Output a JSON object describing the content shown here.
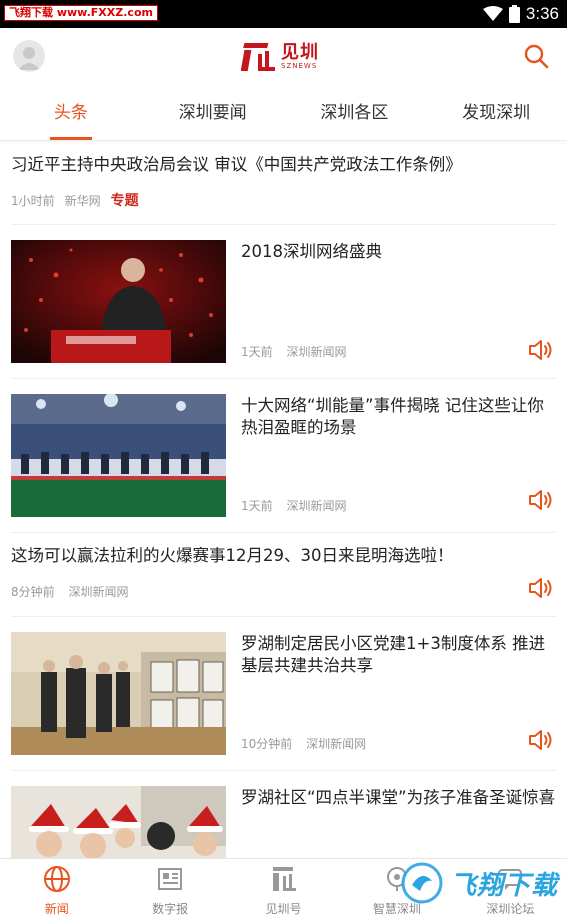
{
  "status_bar": {
    "watermark_badge": "飞翔下载 www.FXXZ.com",
    "time": "3:36"
  },
  "header": {
    "logo_text": "见圳",
    "logo_sub": "SZNEWS",
    "brand_color": "#c4161c",
    "accent_color": "#e8541e"
  },
  "tabs": [
    {
      "label": "头条",
      "active": true
    },
    {
      "label": "深圳要闻",
      "active": false
    },
    {
      "label": "深圳各区",
      "active": false
    },
    {
      "label": "发现深圳",
      "active": false
    }
  ],
  "feed": [
    {
      "type": "text",
      "title": "习近平主持中央政治局会议 审议《中国共产党政法工作条例》",
      "time": "1小时前",
      "source": "新华网",
      "tag": "专题"
    },
    {
      "type": "image",
      "title": "2018深圳网络盛典",
      "time": "1天前",
      "source": "深圳新闻网",
      "image": "speaker-on-stage",
      "audio": true
    },
    {
      "type": "image",
      "title": "十大网络“圳能量”事件揭晓 记住这些让你热泪盈眶的场景",
      "time": "1天前",
      "source": "深圳新闻网",
      "image": "award-ceremony-stage",
      "audio": true
    },
    {
      "type": "text",
      "title": "这场可以赢法拉利的火爆赛事12月29、30日来昆明海选啦！",
      "time": "8分钟前",
      "source": "深圳新闻网",
      "audio": true
    },
    {
      "type": "image",
      "title": "罗湖制定居民小区党建1+3制度体系 推进基层共建共治共享",
      "time": "10分钟前",
      "source": "深圳新闻网",
      "image": "officials-visit-exhibition",
      "audio": true
    },
    {
      "type": "image",
      "title": "罗湖社区“四点半课堂”为孩子准备圣诞惊喜",
      "image": "children-santa-hats"
    }
  ],
  "bottom_nav": [
    {
      "label": "新闻",
      "icon": "globe-icon",
      "active": true
    },
    {
      "label": "数字报",
      "icon": "newspaper-icon",
      "active": false
    },
    {
      "label": "见圳号",
      "icon": "sz-logo-icon",
      "active": false
    },
    {
      "label": "智慧深圳",
      "icon": "smart-city-icon",
      "active": false
    },
    {
      "label": "深圳论坛",
      "icon": "forum-icon",
      "active": false
    }
  ],
  "watermark": {
    "text": "飞翔下载"
  }
}
